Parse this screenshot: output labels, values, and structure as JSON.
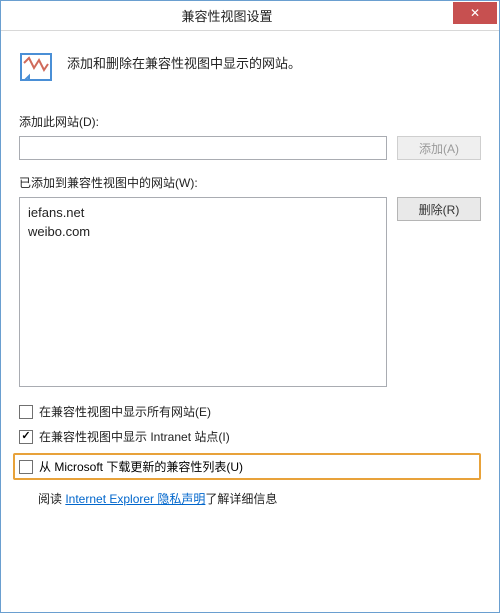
{
  "window": {
    "title": "兼容性视图设置",
    "close_glyph": "✕"
  },
  "header": {
    "description": "添加和删除在兼容性视图中显示的网站。"
  },
  "add_section": {
    "label": "添加此网站(D):",
    "input_value": "",
    "add_button": "添加(A)"
  },
  "list_section": {
    "label": "已添加到兼容性视图中的网站(W):",
    "items": [
      "iefans.net",
      "weibo.com"
    ],
    "remove_button": "删除(R)"
  },
  "options": {
    "show_all": {
      "checked": false,
      "label": "在兼容性视图中显示所有网站(E)"
    },
    "show_intranet": {
      "checked": true,
      "label": "在兼容性视图中显示 Intranet 站点(I)"
    },
    "download_ms": {
      "checked": false,
      "label": "从 Microsoft 下载更新的兼容性列表(U)"
    }
  },
  "footer": {
    "prefix": "阅读 ",
    "link": "Internet Explorer 隐私声明",
    "suffix": "了解详细信息"
  }
}
